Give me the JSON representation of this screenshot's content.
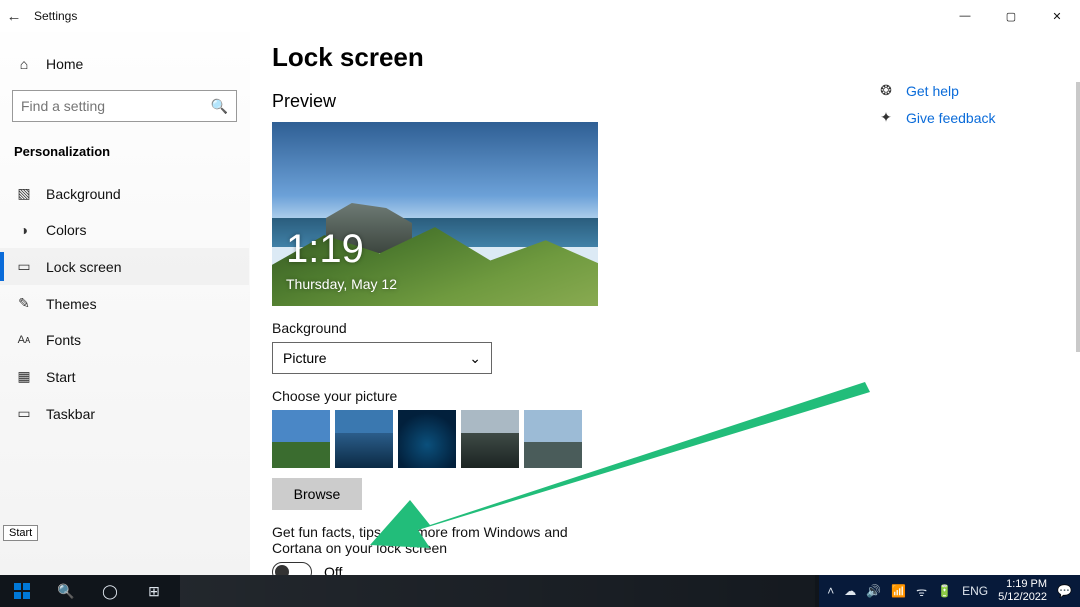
{
  "titlebar": {
    "app": "Settings",
    "min": "—",
    "max": "▢",
    "close": "✕",
    "back": "←"
  },
  "sidebar": {
    "home": "Home",
    "search_placeholder": "Find a setting",
    "category": "Personalization",
    "items": [
      {
        "label": "Background"
      },
      {
        "label": "Colors"
      },
      {
        "label": "Lock screen"
      },
      {
        "label": "Themes"
      },
      {
        "label": "Fonts"
      },
      {
        "label": "Start"
      },
      {
        "label": "Taskbar"
      }
    ]
  },
  "page": {
    "title": "Lock screen",
    "preview_heading": "Preview",
    "preview_time": "1:19",
    "preview_date": "Thursday, May 12",
    "bg_label": "Background",
    "bg_value": "Picture",
    "choose_label": "Choose your picture",
    "browse": "Browse",
    "funfacts_label": "Get fun facts, tips, and more from Windows and Cortana on your lock screen",
    "toggle_state": "Off"
  },
  "links": {
    "help": "Get help",
    "feedback": "Give feedback"
  },
  "start_tooltip": "Start",
  "tray": {
    "lang": "ENG",
    "time": "1:19 PM",
    "date": "5/12/2022"
  }
}
